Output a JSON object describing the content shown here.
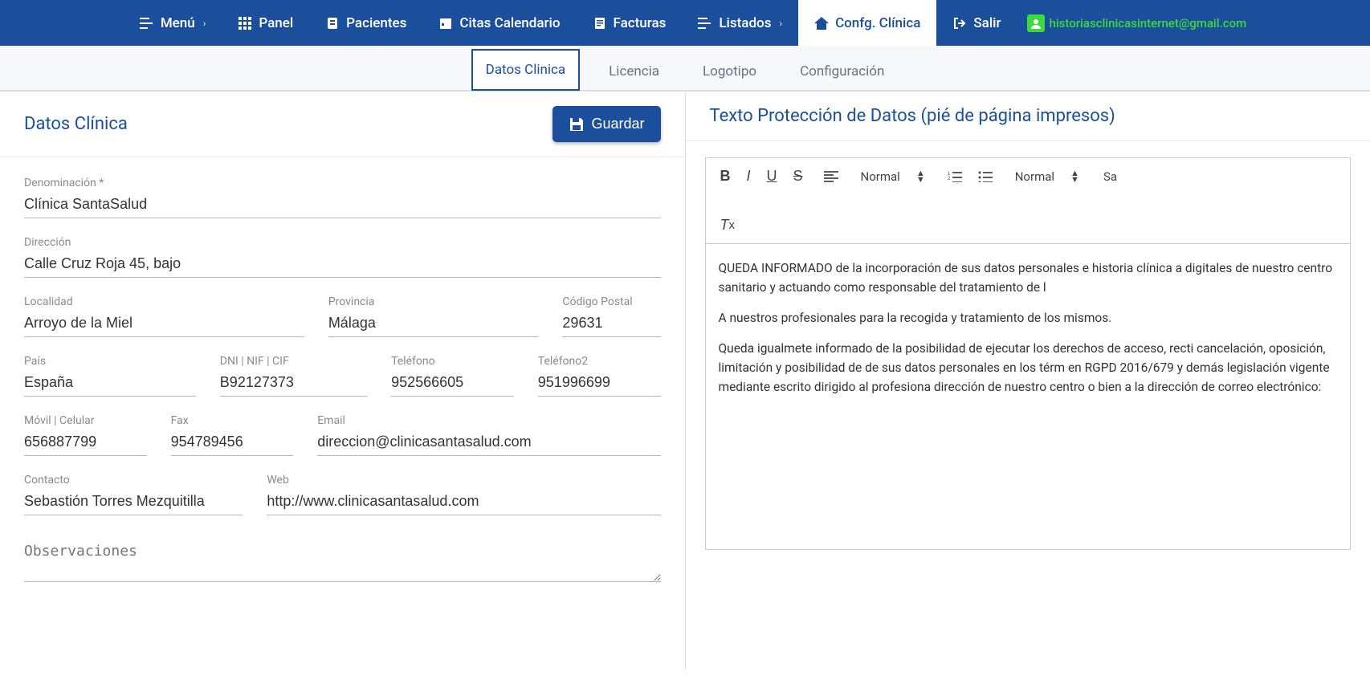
{
  "nav": {
    "menu": "Menú",
    "panel": "Panel",
    "pacientes": "Pacientes",
    "citas": "Citas Calendario",
    "facturas": "Facturas",
    "listados": "Listados",
    "config": "Confg. Clínica",
    "salir": "Salir",
    "user_email": "historiasclinicasinternet@gmail.com"
  },
  "tabs": {
    "datos": "Datos Clinica",
    "licencia": "Licencia",
    "logotipo": "Logotipo",
    "configuracion": "Configuración"
  },
  "left": {
    "title": "Datos Clínica",
    "save": "Guardar",
    "fields": {
      "denominacion_label": "Denominación *",
      "denominacion_value": "Clínica SantaSalud",
      "direccion_label": "Dirección",
      "direccion_value": "Calle Cruz Roja 45, bajo",
      "localidad_label": "Localidad",
      "localidad_value": "Arroyo de la Miel",
      "provincia_label": "Provincia",
      "provincia_value": "Málaga",
      "cp_label": "Código Postal",
      "cp_value": "29631",
      "pais_label": "País",
      "pais_value": "España",
      "dni_label": "DNI | NIF | CIF",
      "dni_value": "B92127373",
      "telefono_label": "Teléfono",
      "telefono_value": "952566605",
      "telefono2_label": "Teléfono2",
      "telefono2_value": "951996699",
      "movil_label": "Móvil | Celular",
      "movil_value": "656887799",
      "fax_label": "Fax",
      "fax_value": "954789456",
      "email_label": "Email",
      "email_value": "direccion@clinicasantasalud.com",
      "contacto_label": "Contacto",
      "contacto_value": "Sebastión Torres Mezquitilla",
      "web_label": "Web",
      "web_value": "http://www.clinicasantasalud.com",
      "observaciones_label": "Observaciones",
      "observaciones_value": ""
    }
  },
  "right": {
    "title": "Texto Protección de Datos (pié de página impresos)",
    "toolbar": {
      "normal1": "Normal",
      "normal2": "Normal",
      "sans": "Sa"
    },
    "paragraphs": {
      "p1": "QUEDA INFORMADO de la incorporación de sus datos personales e historia clínica a digitales de nuestro centro sanitario y actuando como responsable del tratamiento de l",
      "p2": "A nuestros profesionales para la recogida y tratamiento de los mismos.",
      "p3": "Queda igualmete informado de la posibilidad de ejecutar los derechos de acceso, recti cancelación, oposición, limitación y posibilidad de de sus datos personales en los térm en RGPD 2016/679 y demás legislación vigente mediante escrito dirigido al profesiona dirección de nuestro centro o bien a la dirección de correo electrónico:"
    }
  }
}
